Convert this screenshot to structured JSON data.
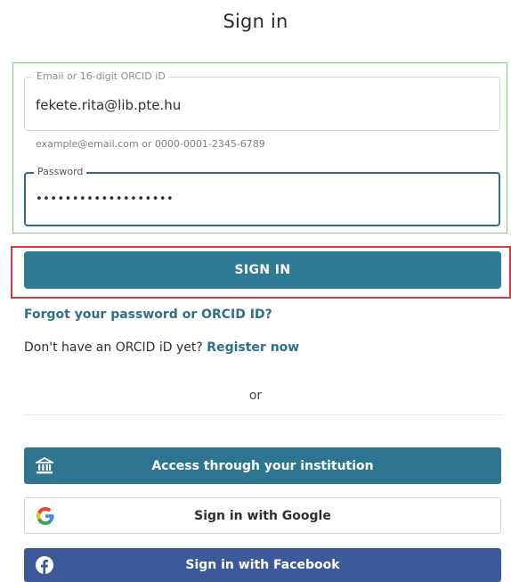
{
  "page": {
    "title": "Sign in"
  },
  "email": {
    "label": "Email or 16-digit ORCID iD",
    "value": "fekete.rita@lib.pte.hu",
    "hint": "example@email.com or 0000-0001-2345-6789"
  },
  "password": {
    "label": "Password",
    "value": "•••••••••••••••••••"
  },
  "signin": {
    "label": "SIGN IN"
  },
  "links": {
    "forgot": "Forgot your password or ORCID ID?",
    "no_account": "Don't have an ORCID iD yet?",
    "register": "Register now"
  },
  "separator": {
    "or": "or"
  },
  "social": {
    "institution": "Access through your institution",
    "google": "Sign in with Google",
    "facebook": "Sign in with Facebook"
  },
  "colors": {
    "primary": "#2f7a94",
    "facebook": "#3c5a99",
    "highlight_red": "#d23c3c",
    "highlight_green": "#7ec97e"
  },
  "icons": {
    "institution": "bank-icon",
    "google": "google-icon",
    "facebook": "facebook-icon"
  }
}
